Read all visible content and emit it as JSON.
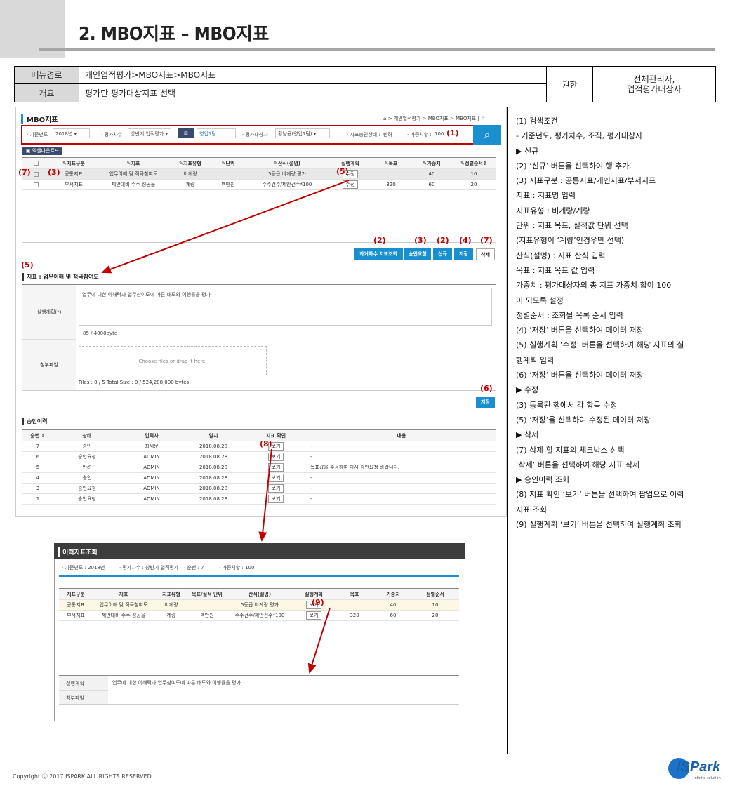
{
  "page": {
    "title": "2. MBO지표 – MBO지표",
    "copyright": "Copyright ⓒ 2017 ISPARK ALL RIGHTS RESERVED.",
    "logo": "ISPark",
    "logo_sub": "Infinite solution"
  },
  "info": {
    "menu_label": "메뉴경로",
    "menu_value": "개인업적평가>MBO지표>MBO지표",
    "overview_label": "개요",
    "overview_value": "평가단 평가대상지표 선택",
    "auth_label": "권한",
    "auth_value_1": "전체관리자,",
    "auth_value_2": "업적평가대상자"
  },
  "screen": {
    "title": "MBO지표",
    "breadcrumb": "⌂ > 개인업적평가 > MBO지표 > MBO지표 | ☆",
    "search": {
      "year_label": "· 기준년도",
      "year_value": "2018년",
      "round_label": "· 평가차수",
      "round_value": "상반기 업적평가",
      "org_value": "영업1팀",
      "target_label": "· 평가대상자",
      "target_value": "황남균(영업1팀)",
      "status_label": "· 지표승인상태 :",
      "status_value": "반려",
      "weight_label": "· 가중치합 :",
      "weight_value": "100"
    },
    "excel_label": "엑셀다운로드",
    "grid_headers": [
      "",
      "지표구분",
      "지표",
      "지표유형",
      "단위",
      "산식(설명)",
      "실행계획",
      "목표",
      "가중치",
      "정렬순서"
    ],
    "grid_rows": [
      [
        "",
        "공통지표",
        "업무이해 및 적극참여도",
        "비계량",
        "",
        "5등급 비계량 평가",
        "수정",
        "",
        "40",
        "10"
      ],
      [
        "",
        "부서지표",
        "제안대비 수주 성공율",
        "계량",
        "백만원",
        "수주건수/제안건수*100",
        "수정",
        "320",
        "60",
        "20"
      ]
    ],
    "buttons": {
      "prev": "과거차수 지표조회",
      "approve": "승인요청",
      "new": "신규",
      "save": "저장",
      "delete": "삭제",
      "save2": "저장"
    },
    "detail_title": "지표 : 업무이해 및 적극참여도",
    "plan_label": "실행계획(*)",
    "plan_text": "업무에 대한 이해력과 업무참여도에 따른 태도와 이행률을 평가",
    "plan_count": "85 / 4000byte",
    "attach_label": "첨부파일",
    "drop_text": "Choose files or drag it here.",
    "files_info": "Files : 0 / 5   Total Size : 0 / 524,288,000 bytes",
    "history_title": "승인이력",
    "history_headers": [
      "순번 ⇕",
      "상태",
      "입력자",
      "일시",
      "지표 확인",
      "내용"
    ],
    "history_rows": [
      [
        "7",
        "승인",
        "최세문",
        "2018.08.28",
        "보기",
        ""
      ],
      [
        "6",
        "승인요청",
        "ADMIN",
        "2018.08.28",
        "보기",
        ""
      ],
      [
        "5",
        "반려",
        "ADMIN",
        "2018.08.28",
        "보기",
        "목표값을 수정하여 다시 승인요청 바랍니다."
      ],
      [
        "4",
        "승인",
        "ADMIN",
        "2018.08.28",
        "보기",
        ""
      ],
      [
        "3",
        "승인요청",
        "ADMIN",
        "2018.08.28",
        "보기",
        ""
      ],
      [
        "1",
        "승인요청",
        "ADMIN",
        "2018.08.28",
        "보기",
        ""
      ]
    ]
  },
  "popup": {
    "title": "이력지표조회",
    "year_label": "· 기준년도",
    "year_value": ": 2018년",
    "round_label": "· 평가차수",
    "round_value": ": 상반기 업적평가",
    "seq_label": "· 순번",
    "seq_value": ": 7",
    "weight_label": "· 가중치합",
    "weight_value": ": 100",
    "headers": [
      "지표구분",
      "지표",
      "지표유형",
      "목표/실적 단위",
      "산식(설명)",
      "실행계획",
      "목표",
      "가중치",
      "정렬순서"
    ],
    "rows": [
      [
        "공통지표",
        "업무이해 및 적극참여도",
        "비계량",
        "",
        "5등급 비계량 평가",
        "보기",
        "",
        "40",
        "10"
      ],
      [
        "부서지표",
        "제안대비 수주 성공율",
        "계량",
        "백만원",
        "수주건수/제안건수*100",
        "보기",
        "320",
        "60",
        "20"
      ]
    ],
    "plan_label": "실행계획",
    "plan_text": "업무에 대한 이해력과 업무참여도에 따른 태도와 이행률을 평가",
    "attach_label": "첨부파일"
  },
  "markers": {
    "m1": "(1)",
    "m2": "(2)",
    "m3": "(3)",
    "m4": "(4)",
    "m5": "(5)",
    "m6": "(6)",
    "m7": "(7)",
    "m8": "(8)",
    "m9": "(9)"
  },
  "right_panel": [
    "(1)  검색조건",
    "-    기준년도, 평가차수, 조직, 평가대상자",
    "▶ 신규",
    "(2)  ‘신규’ 버튼을 선택하여 행 추가.",
    "(3)  지표구분 : 공통지표/개인지표/부서지표",
    "       지표 : 지표명 입력",
    "       지표유형 : 비계량/계량",
    "       단위 : 지표 목표, 실적값 단위 선택",
    "               (지표유형이 ‘계량’인경우만 선택)",
    "       산식(설명) : 지표 산식 입력",
    "       목표 : 지표 목표 값 입력",
    "       가중치 : 평가대상자의 총 지표 가중치 합이 100",
    "       이 되도록 설정",
    "       정렬순서 : 조회될 목록 순서 입력",
    "(4)  ‘저장’ 버튼을 선택하여 데이터 저장",
    "(5)  실행계획 ‘수정’ 버튼을 선택하여 해당 지표의 실",
    "       행계획 입력",
    "(6)  ‘저장’ 버튼을 선택하여 데이터 저장",
    "▶ 수정",
    "(3)  등록된 행에서 각 항목 수정",
    "(5)  ‘저장’을 선택하여 수정된 데이터 저장",
    "▶ 삭제",
    "(7)  삭제 할 지표의 체크박스 선택",
    "       ‘삭제’ 버튼을 선택하여 해당 지표 삭제",
    "▶ 승인이력 조회",
    "(8)  지표 확인 ‘보기’ 버튼을 선택하여 팝업으로 이력",
    "       지표 조회",
    "(9)  실행계획 ‘보기’ 버튼을 선택하여 실행계획 조회"
  ]
}
